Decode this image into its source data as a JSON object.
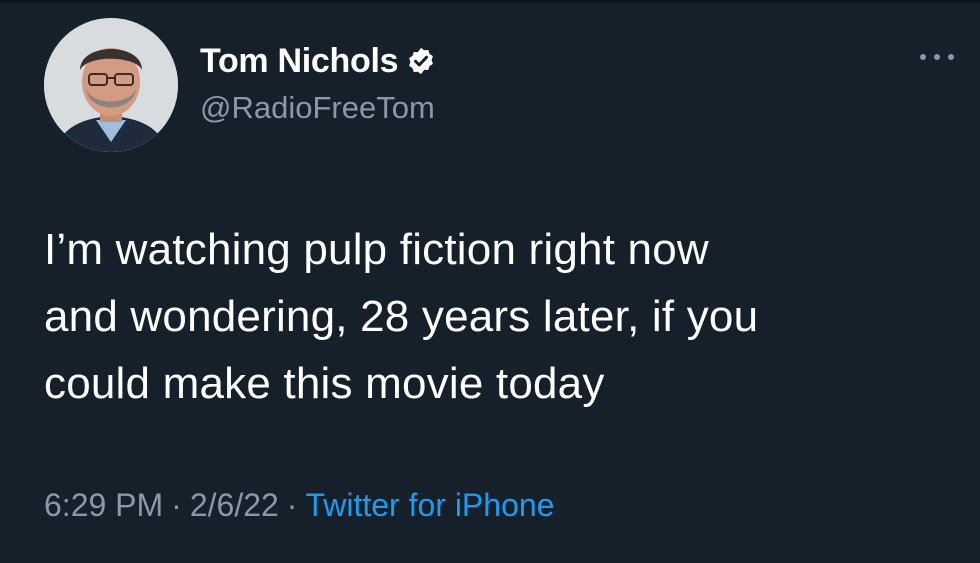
{
  "colors": {
    "background": "#15202b",
    "text_primary": "#ffffff",
    "text_secondary": "#8b98a5",
    "link": "#1d9bf0"
  },
  "author": {
    "display_name": "Tom Nichols",
    "handle": "@RadioFreeTom",
    "verified_icon": "verified-badge-icon",
    "avatar_icon": "profile-photo"
  },
  "menu": {
    "icon": "more-options-icon"
  },
  "tweet": {
    "lines": [
      "I’m watching pulp fiction right now",
      "and wondering, 28 years later, if you",
      "could make this movie today"
    ]
  },
  "meta": {
    "time": "6:29 PM",
    "separator": "·",
    "date": "2/6/22",
    "source": "Twitter for iPhone"
  }
}
